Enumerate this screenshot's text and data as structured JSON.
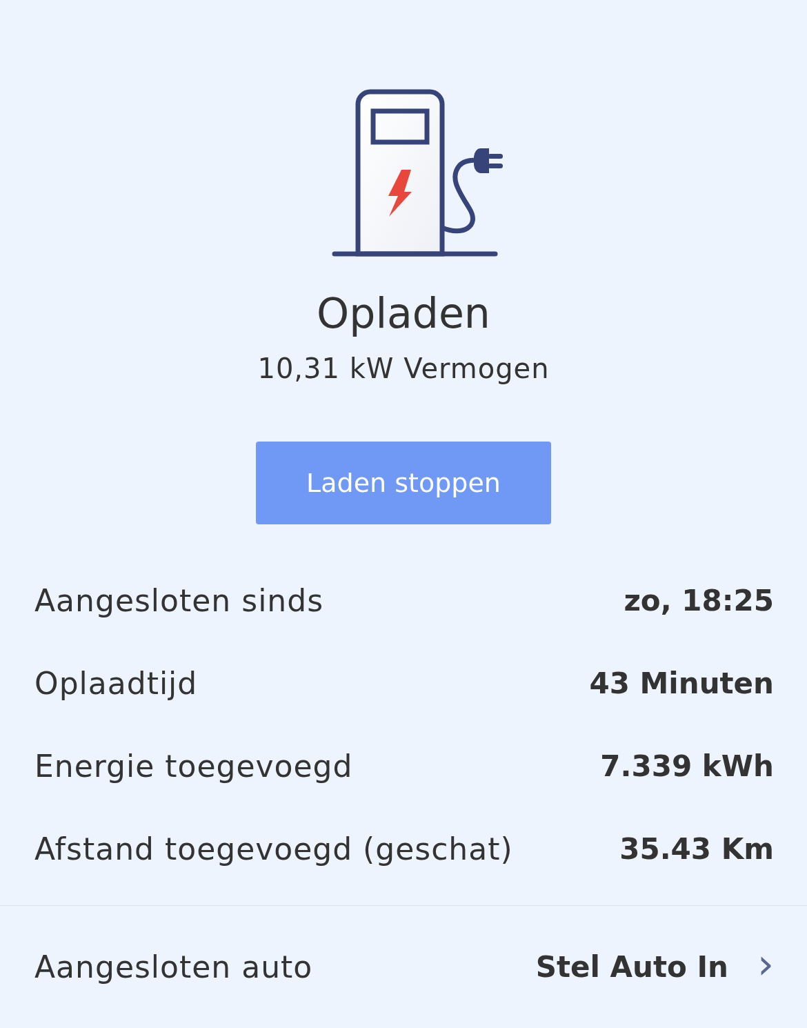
{
  "status": {
    "title": "Opladen",
    "power": "10,31 kW Vermogen"
  },
  "action_button": {
    "label": "Laden stoppen"
  },
  "details": [
    {
      "label": "Aangesloten sinds",
      "value": "zo, 18:25"
    },
    {
      "label": "Oplaadtijd",
      "value": "43 Minuten"
    },
    {
      "label": "Energie toegevoegd",
      "value": "7.339 kWh"
    },
    {
      "label": "Afstand toegevoegd (geschat)",
      "value": "35.43 Km"
    }
  ],
  "connected_car": {
    "label": "Aangesloten auto",
    "value": "Stel Auto In",
    "chevron": "›"
  }
}
